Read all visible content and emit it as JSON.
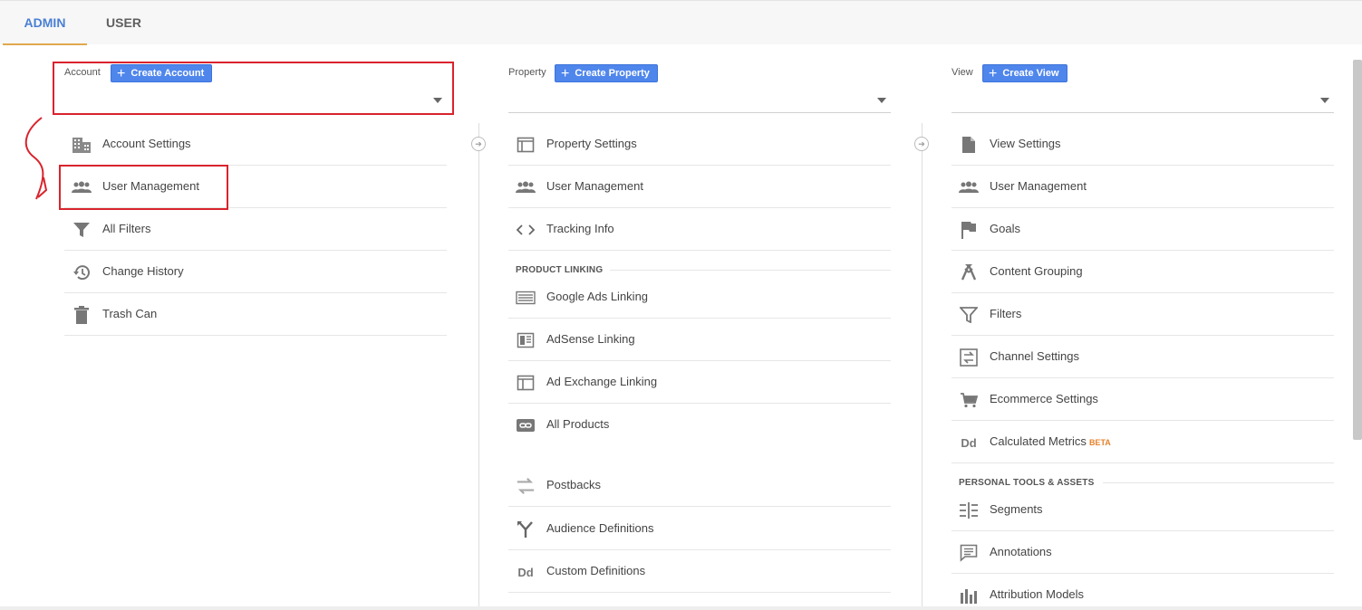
{
  "tabs": {
    "admin": "ADMIN",
    "user": "USER"
  },
  "account": {
    "label": "Account",
    "create_button": "Create Account",
    "items": [
      {
        "label": "Account Settings",
        "icon": "building-icon"
      },
      {
        "label": "User Management",
        "icon": "people-icon"
      },
      {
        "label": "All Filters",
        "icon": "filter-icon"
      },
      {
        "label": "Change History",
        "icon": "history-icon"
      },
      {
        "label": "Trash Can",
        "icon": "trash-icon"
      }
    ]
  },
  "property": {
    "label": "Property",
    "create_button": "Create Property",
    "items": [
      {
        "label": "Property Settings",
        "icon": "layout-icon"
      },
      {
        "label": "User Management",
        "icon": "people-icon"
      },
      {
        "label": "Tracking Info",
        "icon": "code-icon"
      }
    ],
    "product_linking_header": "PRODUCT LINKING",
    "linking_items": [
      {
        "label": "Google Ads Linking",
        "icon": "ads-icon"
      },
      {
        "label": "AdSense Linking",
        "icon": "adsense-icon"
      },
      {
        "label": "Ad Exchange Linking",
        "icon": "adexchange-icon"
      },
      {
        "label": "All Products",
        "icon": "link-icon"
      }
    ],
    "more_items": [
      {
        "label": "Postbacks",
        "icon": "postbacks-icon"
      },
      {
        "label": "Audience Definitions",
        "icon": "fork-icon"
      },
      {
        "label": "Custom Definitions",
        "icon": "dd-icon",
        "icon_text": "Dd"
      }
    ]
  },
  "view": {
    "label": "View",
    "create_button": "Create View",
    "items": [
      {
        "label": "View Settings",
        "icon": "document-icon"
      },
      {
        "label": "User Management",
        "icon": "people-icon"
      },
      {
        "label": "Goals",
        "icon": "flag-icon"
      },
      {
        "label": "Content Grouping",
        "icon": "grouping-icon"
      },
      {
        "label": "Filters",
        "icon": "filter-icon"
      },
      {
        "label": "Channel Settings",
        "icon": "channel-icon"
      },
      {
        "label": "Ecommerce Settings",
        "icon": "cart-icon"
      },
      {
        "label": "Calculated Metrics",
        "icon": "dd-icon",
        "icon_text": "Dd",
        "badge": "BETA"
      }
    ],
    "personal_header": "PERSONAL TOOLS & ASSETS",
    "personal_items": [
      {
        "label": "Segments",
        "icon": "segments-icon"
      },
      {
        "label": "Annotations",
        "icon": "comment-icon"
      },
      {
        "label": "Attribution Models",
        "icon": "bars-icon"
      }
    ]
  },
  "colors": {
    "accent": "#4f86ec",
    "tab_active": "#4a7fd3",
    "tab_underline": "#e0a84d",
    "highlight": "#d9232d",
    "beta": "#e5822d"
  }
}
